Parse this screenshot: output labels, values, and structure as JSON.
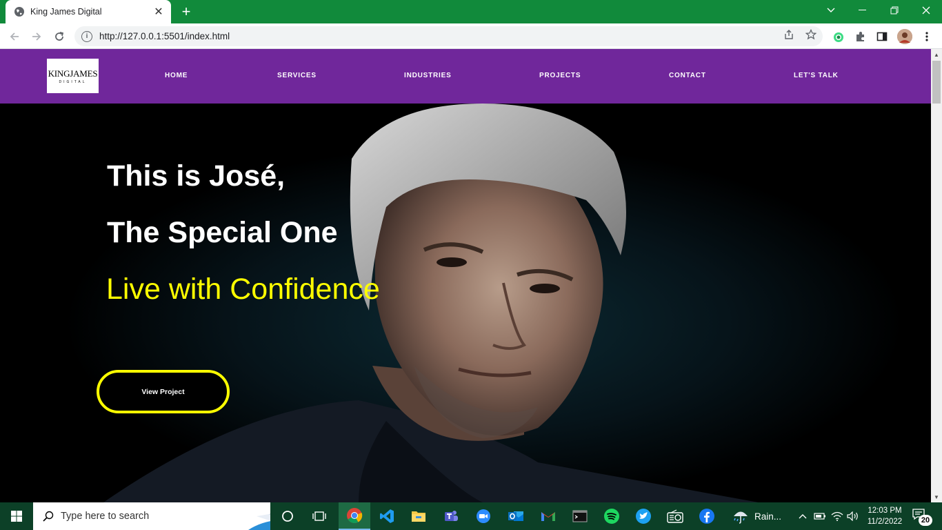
{
  "browser": {
    "tab_title": "King James Digital",
    "tab_close": "✕",
    "new_tab": "+",
    "url": "http://127.0.0.1:5501/index.html",
    "colors": {
      "titlebar": "#118a3b",
      "toolbar": "#ffffff"
    }
  },
  "site": {
    "logo_main": "KINGJAMES",
    "logo_sub": "DIGITAL",
    "nav": {
      "home": "HOME",
      "services": "SERVICES",
      "industries": "INDUSTRIES",
      "projects": "PROJECTS",
      "contact": "CONTACT",
      "lets_talk": "LET'S TALK"
    },
    "hero": {
      "line1": "This is José,",
      "line2": "The Special One",
      "line3": "Live with Confidence",
      "cta": "View Project"
    },
    "colors": {
      "nav_bg": "#70279b",
      "accent": "#ffff00",
      "hero_bg": "#000000"
    }
  },
  "taskbar": {
    "search_placeholder": "Type here to search",
    "weather": "Rain...",
    "time": "12:03 PM",
    "date": "11/2/2022",
    "notification_count": "20",
    "apps": [
      "cortana-icon",
      "task-view-icon",
      "chrome-icon",
      "vscode-icon",
      "file-explorer-icon",
      "teams-icon",
      "zoom-icon",
      "outlook-icon",
      "gmail-icon",
      "terminal-icon",
      "spotify-icon",
      "twitter-icon",
      "radio-icon",
      "facebook-icon"
    ]
  }
}
